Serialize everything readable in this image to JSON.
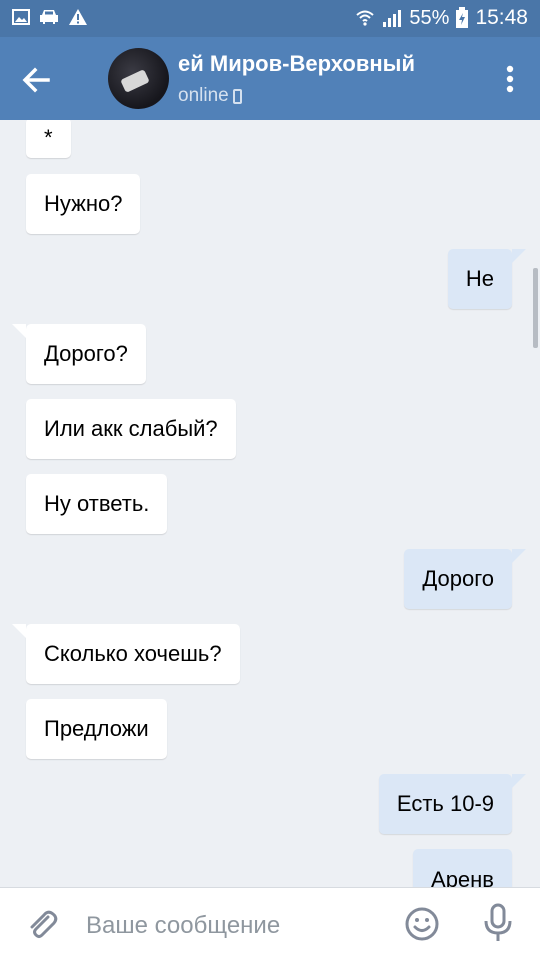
{
  "status_bar": {
    "battery": "55%",
    "time": "15:48"
  },
  "header": {
    "contact_name": "ей Миров-Верховный",
    "status": "online"
  },
  "messages": [
    {
      "side": "in",
      "text": "*"
    },
    {
      "side": "in",
      "text": "Нужно?"
    },
    {
      "side": "out",
      "text": "Не"
    },
    {
      "side": "in",
      "text": "Дорого?"
    },
    {
      "side": "in",
      "text": "Или акк слабый?"
    },
    {
      "side": "in",
      "text": "Ну ответь."
    },
    {
      "side": "out",
      "text": "Дорого"
    },
    {
      "side": "in",
      "text": "Сколько хочешь?"
    },
    {
      "side": "in",
      "text": "Предложи"
    },
    {
      "side": "out",
      "text": "Есть 10-9"
    },
    {
      "side": "out",
      "text": "Аренв"
    }
  ],
  "composer": {
    "placeholder": "Ваше сообщение"
  },
  "colors": {
    "header": "#5181b8",
    "status_bar": "#4a76a8",
    "background": "#edf0f4",
    "incoming_bubble": "#ffffff",
    "outgoing_bubble": "#dbe7f6"
  },
  "icons": {
    "status_left": [
      "image-icon",
      "car-icon",
      "warning-icon"
    ],
    "status_right": [
      "wifi-icon",
      "signal-icon",
      "battery-charging-icon"
    ],
    "header": [
      "back-arrow-icon",
      "more-vert-icon"
    ],
    "composer": [
      "attach-icon",
      "emoji-icon",
      "mic-icon"
    ]
  }
}
